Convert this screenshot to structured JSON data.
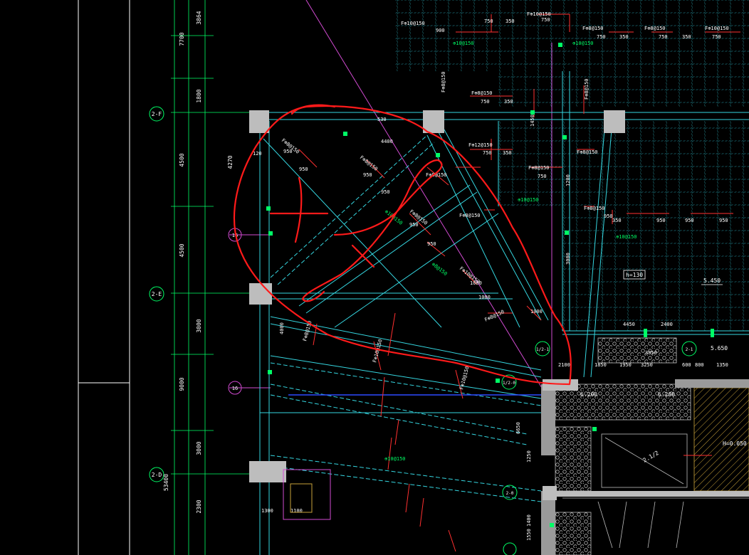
{
  "colors": {
    "background": "#000000",
    "grid_line": "#00ff66",
    "beam": "#35d6e0",
    "rebar": "#ff3030",
    "annotation": "#ff1a1a",
    "column": "#bdbdbd",
    "magenta": "#d24bd2",
    "blue": "#2e4bff",
    "dimension": "#ffffff"
  },
  "axis_bubbles": {
    "a1": "2-F",
    "a2": "2-E",
    "a3": "2-D",
    "b1": "1/2-1",
    "b2": "1/2-0",
    "b3": "2-1",
    "b4": "2-0",
    "c1": "16",
    "c2": "16"
  },
  "left_dims": {
    "d1": "7700",
    "d2": "3864",
    "d3": "1800",
    "d4": "4500",
    "d5": "4500",
    "d6": "3000",
    "d7": "9000",
    "d8": "3000",
    "d9": "53400",
    "d10": "2300",
    "d11": "4270"
  },
  "rebar_labels": {
    "r1": "F⊕10@150",
    "r2": "F⊕10@150",
    "r3": "F⊕8@150",
    "r4": "F⊕8@150",
    "r5": "F⊕10@150",
    "r6": "F⊕8@150",
    "r7": "F⊕8@150",
    "r8": "F⊕8@150",
    "r9": "F⊕12@150",
    "r10": "F⊕8@150",
    "r11": "F⊕8@150",
    "r12": "F⊕8@150",
    "r13": "F⊕8@150",
    "r14": "F⊕8@150",
    "r15": "F⊕8@150",
    "r16": "F⊕8@150",
    "r17": "F⊕10@150",
    "r18": "F⊕8@150",
    "r19": "F⊕8@150",
    "r20": "F⊕10@150",
    "r21": "F⊕10@150",
    "r22": "F⊕8@150"
  },
  "green_labels": {
    "g1": "⊕10@150",
    "g2": "⊕10@150",
    "g3": "⊕10@150",
    "g4": "⊕10@150",
    "g5": "⊕10@150",
    "g6": "⊕10@150",
    "g7": "⊕8@150"
  },
  "numbers": {
    "n750": "750",
    "n350": "350",
    "n900": "900",
    "n950": "950",
    "n4400": "4400",
    "n530": "530",
    "n1000": "1000",
    "n1450": "1450",
    "n1200": "1200",
    "n3000": "3000",
    "n1850": "1850",
    "n1950": "1950",
    "n3250": "3250",
    "n3850": "3850",
    "n600": "600",
    "n800": "800",
    "n1350": "1350",
    "n2100": "2100",
    "n2400": "2400",
    "n4450": "4450",
    "n4000": "4000",
    "n1300": "1300",
    "n1100": "1100",
    "n1400": "1400",
    "n1550": "1550",
    "n6650": "6650",
    "n1250": "1250",
    "n120": "120"
  },
  "elevations": {
    "e1": "h=130",
    "e2": "5.450",
    "e3": "5.650",
    "e4": "6.200",
    "e5": "6.200",
    "e6": "H=0.050",
    "e7": "2.1/2"
  }
}
